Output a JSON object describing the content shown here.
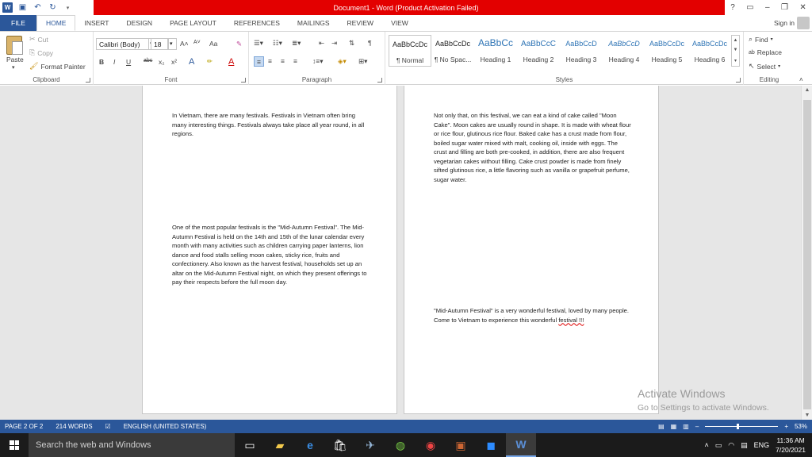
{
  "window": {
    "title": "Document1 - Word (Product Activation Failed)",
    "controls": {
      "help": "?",
      "restore_ribbon": "▭",
      "minimize": "–",
      "restore": "❐",
      "close": "✕"
    }
  },
  "qat": {
    "app_icon": "W"
  },
  "tabs": [
    {
      "label": "FILE"
    },
    {
      "label": "HOME"
    },
    {
      "label": "INSERT"
    },
    {
      "label": "DESIGN"
    },
    {
      "label": "PAGE LAYOUT"
    },
    {
      "label": "REFERENCES"
    },
    {
      "label": "MAILINGS"
    },
    {
      "label": "REVIEW"
    },
    {
      "label": "VIEW"
    }
  ],
  "signin": "Sign in",
  "clipboard": {
    "paste": "Paste",
    "cut": "Cut",
    "copy": "Copy",
    "format_painter": "Format Painter",
    "label": "Clipboard"
  },
  "font": {
    "family": "Calibri (Body)",
    "size": "18",
    "case_btn": "Aa",
    "label": "Font",
    "bold": "B",
    "italic": "I",
    "underline": "U",
    "strike": "abc",
    "sub": "x₂",
    "sup": "x²",
    "grow": "A˄",
    "shrink": "A˅"
  },
  "paragraph": {
    "label": "Paragraph",
    "pilcrow": "¶"
  },
  "styles": {
    "label": "Styles",
    "items": [
      {
        "preview": "AaBbCcDc",
        "name": "¶ Normal"
      },
      {
        "preview": "AaBbCcDc",
        "name": "¶ No Spac..."
      },
      {
        "preview": "AaBbCc",
        "name": "Heading 1"
      },
      {
        "preview": "AaBbCcC",
        "name": "Heading 2"
      },
      {
        "preview": "AaBbCcD",
        "name": "Heading 3"
      },
      {
        "preview": "AaBbCcD",
        "name": "Heading 4"
      },
      {
        "preview": "AaBbCcDc",
        "name": "Heading 5"
      },
      {
        "preview": "AaBbCcDc",
        "name": "Heading 6"
      }
    ]
  },
  "editing": {
    "label": "Editing",
    "find": "Find",
    "replace": "Replace",
    "select": "Select"
  },
  "document": {
    "page1": {
      "p1": "In Vietnam, there are many festivals. Festivals in Vietnam often bring many interesting things. Festivals always take place all year round, in all regions.",
      "p2": "One of the most popular festivals is the \"Mid-Autumn Festival\". The Mid-Autumn Festival is held on the 14th and 15th of the lunar calendar every month with many activities such as children carrying paper lanterns, lion dance and food stalls selling moon cakes, sticky rice, fruits and confectionery. Also known as the harvest festival, households set up an altar on the Mid-Autumn Festival night, on which they present offerings to pay their respects before the full moon day."
    },
    "page2": {
      "p1": "Not only that, on this festival, we can eat a kind of cake called \"Moon Cake\". Moon cakes are usually round in shape. It is made with wheat flour or rice flour, glutinous rice flour. Baked cake has a crust made from flour, boiled sugar water mixed with malt, cooking oil, inside with eggs. The crust and filling are both pre-cooked, in addition, there are also frequent vegetarian cakes without filling. Cake crust powder is made from finely sifted glutinous rice, a little flavoring such as vanilla or grapefruit perfume, sugar water.",
      "p2_main": "\"Mid-Autumn Festival\" is a very wonderful festival, loved by many people. Come to Vietnam to experience this wonderful ",
      "p2_squig": "festival !!!"
    }
  },
  "watermark": {
    "line1": "Activate Windows",
    "line2": "Go to Settings to activate Windows."
  },
  "status": {
    "page": "PAGE 2 OF 2",
    "words": "214 WORDS",
    "language": "ENGLISH (UNITED STATES)",
    "zoom": "53%",
    "zoom_minus": "–",
    "zoom_plus": "+"
  },
  "taskbar": {
    "search_placeholder": "Search the web and Windows",
    "lang": "ENG",
    "time": "11:36 AM",
    "date": "7/20/2021"
  }
}
